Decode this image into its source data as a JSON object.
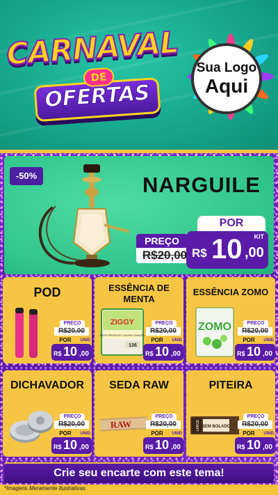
{
  "header": {
    "title_line1": "CARNAVAL",
    "title_connector": "DE",
    "title_line2": "OFERTAS",
    "logo_line1": "Sua Logo",
    "logo_line2": "Aqui"
  },
  "featured": {
    "discount": "-50%",
    "name": "NARGUILE",
    "preco_label": "PREÇO",
    "old_price": "R$20,00",
    "por_label": "POR",
    "currency": "R$",
    "price_int": "10",
    "price_dec": ",00",
    "unit": "KIT"
  },
  "products": [
    {
      "name": "POD",
      "preco_label": "PREÇO",
      "old_price": "R$20,00",
      "por_label": "POR",
      "currency": "R$",
      "price_int": "10",
      "price_dec": ",00",
      "unit": "UNID"
    },
    {
      "name": "ESSÊNCIA DE MENTA",
      "preco_label": "PREÇO",
      "old_price": "R$20,00",
      "por_label": "POR",
      "currency": "R$",
      "price_int": "10",
      "price_dec": ",00",
      "unit": "UNID",
      "pack_brand": "ZIGGY",
      "pack_warning": "ESTE PRODUTO CAUSA CÂNCER",
      "pack_code": "136"
    },
    {
      "name": "ESSÊNCIA ZOMO",
      "preco_label": "PREÇO",
      "old_price": "R$20,00",
      "por_label": "POR",
      "currency": "R$",
      "price_int": "10",
      "price_dec": ",00",
      "unit": "UNID",
      "pack_brand": "ZOMO"
    },
    {
      "name": "DICHAVADOR",
      "preco_label": "PREÇO",
      "old_price": "R$20,00",
      "por_label": "POR",
      "currency": "R$",
      "price_int": "10",
      "price_dec": ",00",
      "unit": "UNID"
    },
    {
      "name": "SEDA RAW",
      "preco_label": "PREÇO",
      "old_price": "R$20,00",
      "por_label": "POR",
      "currency": "R$",
      "price_int": "10",
      "price_dec": ",00",
      "unit": "UNID",
      "pack_brand": "RAW"
    },
    {
      "name": "PITEIRA",
      "preco_label": "PREÇO",
      "old_price": "R$20,00",
      "por_label": "POR",
      "currency": "R$",
      "price_int": "10",
      "price_dec": ",00",
      "unit": "UNID",
      "pack_brand": "BEM BOLADO",
      "pack_size": "LARGE"
    }
  ],
  "cta": "Crie seu encarte com este tema!",
  "disclaimer": "*Imagens Meramente Ilustrativas",
  "colors": {
    "purple": "#5a1ba8",
    "gold": "#f5c543",
    "teal": "#17a88d",
    "green_card": "#2fc58a",
    "title_yellow": "#ffd21f"
  }
}
